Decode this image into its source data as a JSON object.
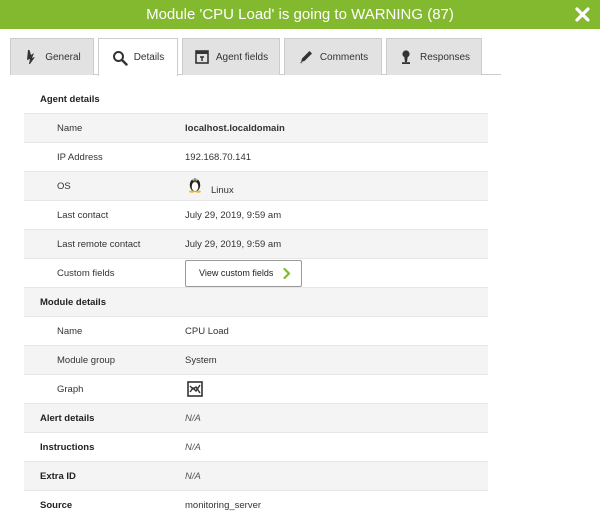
{
  "window": {
    "title": "Module 'CPU Load' is going to WARNING (87)",
    "close_icon": "close-icon"
  },
  "tabs": [
    {
      "label": "General",
      "icon": "flag-icon"
    },
    {
      "label": "Details",
      "icon": "magnifier-icon",
      "active": true
    },
    {
      "label": "Agent fields",
      "icon": "form-icon"
    },
    {
      "label": "Comments",
      "icon": "pencil-icon"
    },
    {
      "label": "Responses",
      "icon": "person-icon"
    }
  ],
  "agent_details": {
    "heading": "Agent details",
    "name_label": "Name",
    "name_value": "localhost.localdomain",
    "ip_label": "IP Address",
    "ip_value": "192.168.70.141",
    "os_label": "OS",
    "os_value": "Linux",
    "os_icon": "tux-icon",
    "last_contact_label": "Last contact",
    "last_contact_value": "July 29, 2019, 9:59 am",
    "last_remote_label": "Last remote contact",
    "last_remote_value": "July 29, 2019, 9:59 am",
    "custom_fields_label": "Custom fields",
    "custom_fields_button": "View custom fields"
  },
  "module_details": {
    "heading": "Module details",
    "name_label": "Name",
    "name_value": "CPU Load",
    "group_label": "Module group",
    "group_value": "System",
    "graph_label": "Graph",
    "graph_icon": "chart-icon"
  },
  "alert_details": {
    "label": "Alert details",
    "value": "N/A"
  },
  "instructions": {
    "label": "Instructions",
    "value": "N/A"
  },
  "extra_id": {
    "label": "Extra ID",
    "value": "N/A"
  },
  "source": {
    "label": "Source",
    "value": "monitoring_server"
  },
  "colors": {
    "accent": "#82b92e",
    "chevron": "#82b92e"
  }
}
